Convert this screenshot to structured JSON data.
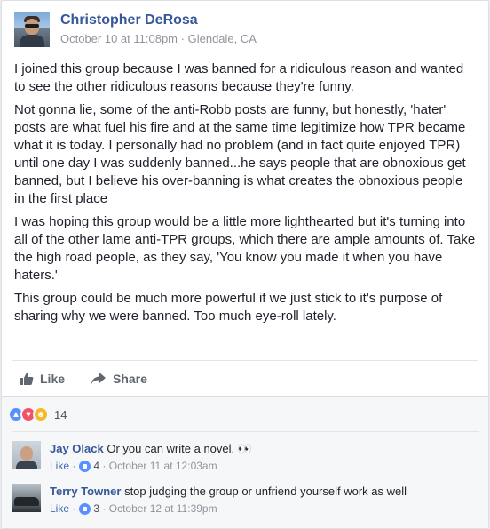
{
  "post": {
    "author": "Christopher DeRosa",
    "date": "October 10 at 11:08pm",
    "separator": "·",
    "location": "Glendale, CA",
    "paragraphs": [
      "I joined this group because I was banned for a ridiculous reason and wanted to see the other ridiculous reasons because they're funny.",
      "Not gonna lie, some of the anti-Robb posts are funny, but honestly, 'hater' posts are what fuel his fire and at the same time legitimize how TPR became what it is today. I personally had no problem (and in fact quite enjoyed TPR) until one day I was suddenly banned...he says people that are obnoxious get banned, but I believe his over-banning is what creates the obnoxious people in the first place",
      "I was hoping this group would be a little more lighthearted but it's turning into all of the other lame anti-TPR groups, which there are ample amounts of. Take the high road people, as they say, 'You know you made it when you have haters.'",
      "This group could be much more powerful if we just stick to it's purpose of sharing why we were banned. Too much eye-roll lately."
    ]
  },
  "actions": {
    "like_label": "Like",
    "share_label": "Share"
  },
  "reactions": {
    "count": "14",
    "types": [
      "like-icon",
      "love-icon",
      "haha-icon"
    ]
  },
  "comments": [
    {
      "name": "Jay Olack",
      "text": "Or you can write a novel. 👀",
      "like_label": "Like",
      "dot": "·",
      "likes": "4",
      "time": "October 11 at 12:03am"
    },
    {
      "name": "Terry Towner",
      "text": "stop judging the group or unfriend yourself work as well",
      "like_label": "Like",
      "dot": "·",
      "likes": "3",
      "time": "October 12 at 11:39pm"
    }
  ],
  "colors": {
    "link": "#365899",
    "meta": "#90949c",
    "like_blue": "#5890ff",
    "love": "#f25268",
    "haha": "#f7b928"
  }
}
